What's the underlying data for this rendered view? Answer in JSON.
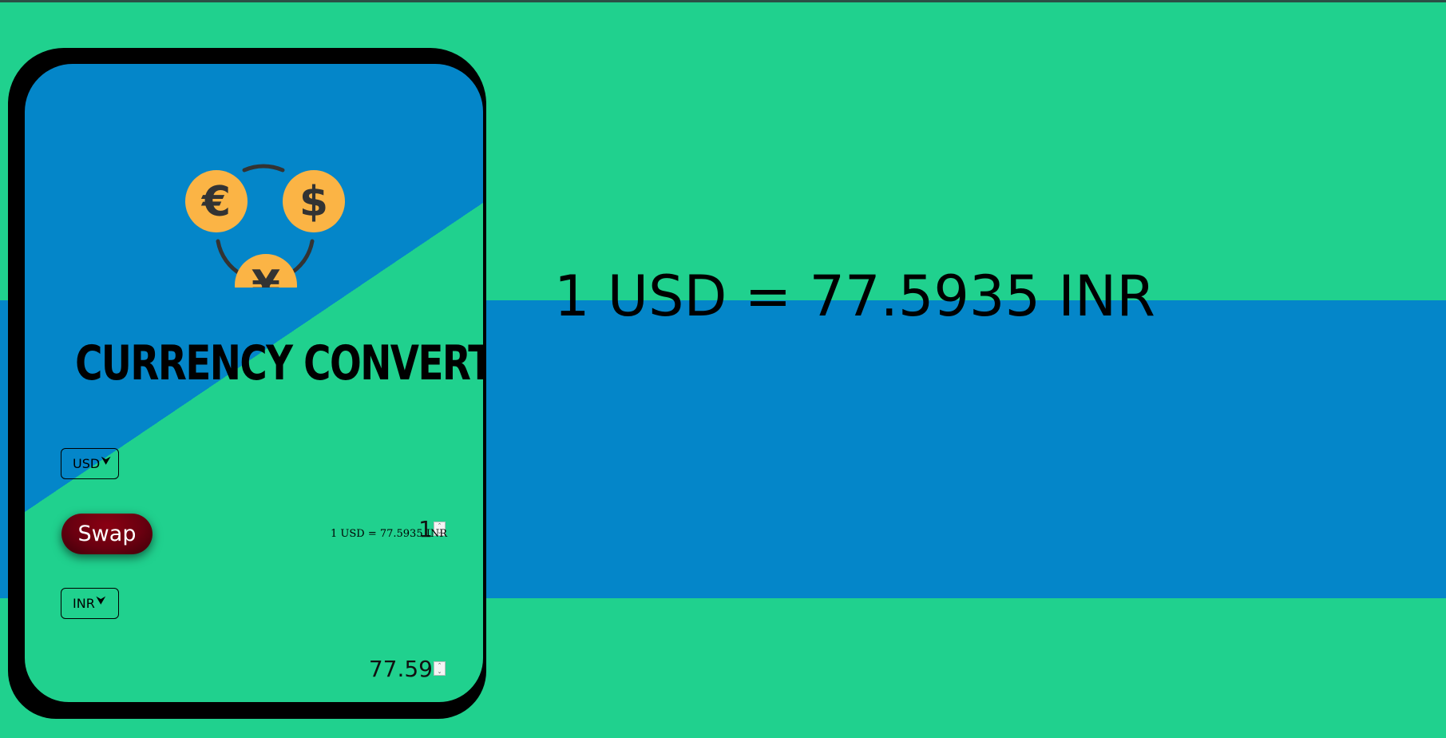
{
  "app": {
    "title": "CURRENCY CONVERTOR",
    "result_text": "1 USD = 77.5935 INR"
  },
  "converter": {
    "from_currency": "USD",
    "to_currency": "INR",
    "from_amount": "1",
    "to_amount": "77.59",
    "swap_label": "Swap",
    "rate_text": "1 USD = 77.5935 INR"
  },
  "icons": {
    "logo": "currency-exchange-icon",
    "coins": [
      "€",
      "$",
      "¥"
    ],
    "dropdown": "chevron-down-icon"
  },
  "colors": {
    "green": "#20d18e",
    "blue": "#0486c9",
    "coin": "#fbb445",
    "swap": "#6a0010"
  }
}
